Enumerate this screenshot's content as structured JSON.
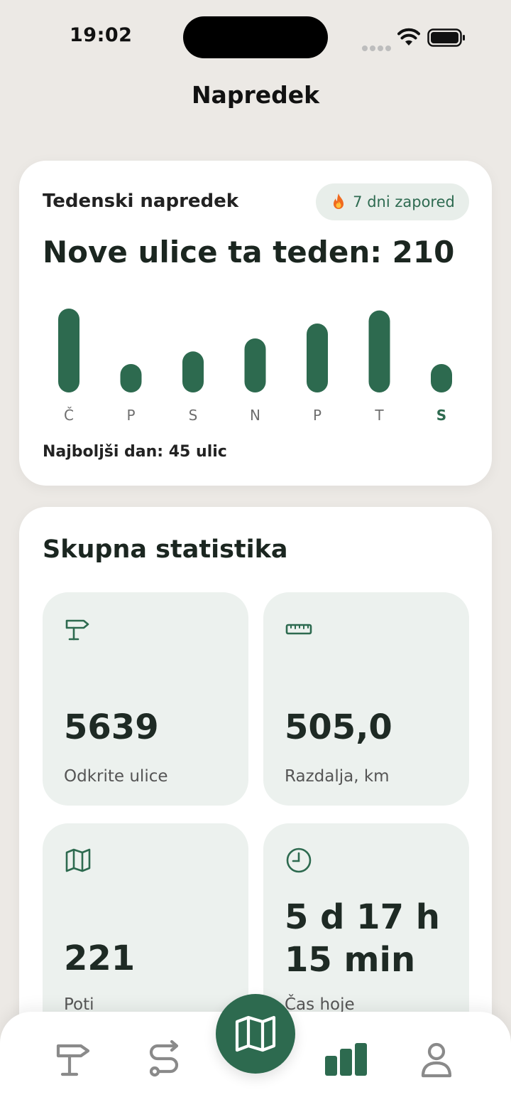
{
  "status": {
    "time": "19:02"
  },
  "header": {
    "title": "Napredek"
  },
  "weekly": {
    "label": "Tedenski napredek",
    "streak": "7 dni zapored",
    "headline": "Nove ulice ta teden: 210",
    "best_day": "Najboljši dan: 45 ulic"
  },
  "chart_data": {
    "type": "bar",
    "categories": [
      "Č",
      "P",
      "S",
      "N",
      "P",
      "T",
      "S"
    ],
    "values": [
      45,
      14,
      22,
      29,
      37,
      44,
      13
    ],
    "highlight_index": 6,
    "colors": {
      "bar": "#2D6A4F",
      "label": "#6E6E6E",
      "highlight_label": "#2D6A4F"
    }
  },
  "totals": {
    "title": "Skupna statistika",
    "tiles": [
      {
        "icon": "signpost-icon",
        "value": "5639",
        "label": "Odkrite ulice"
      },
      {
        "icon": "ruler-icon",
        "value": "505,0",
        "label": "Razdalja, km"
      },
      {
        "icon": "map-icon",
        "value": "221",
        "label": "Poti"
      },
      {
        "icon": "clock-icon",
        "value_line1": "5 d 17 h",
        "value_line2": "15 min",
        "label": "Čas hoje"
      }
    ]
  },
  "nav": {
    "items": [
      "signpost-icon",
      "route-icon",
      "map-icon",
      "stats-icon",
      "profile-icon"
    ],
    "active": "stats-icon"
  },
  "colors": {
    "accent": "#2D6A4F",
    "background": "#ECE9E5",
    "tile": "#ECF1EE",
    "badge": "#E8EEEA"
  }
}
